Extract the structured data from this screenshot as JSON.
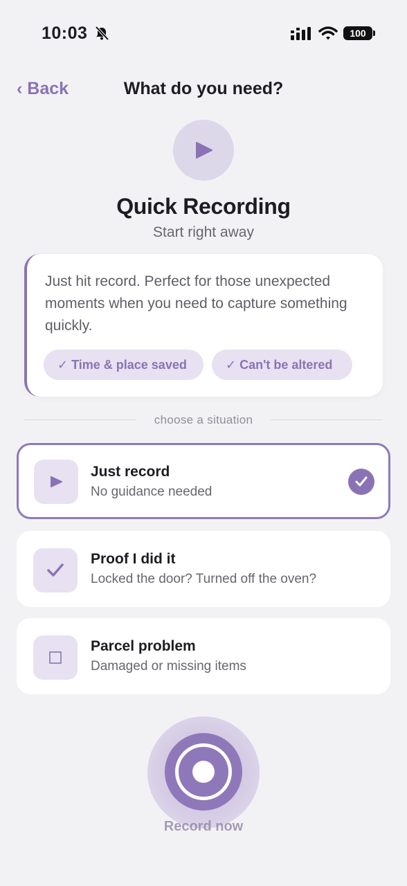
{
  "status_bar": {
    "time": "10:03",
    "battery": "100"
  },
  "nav": {
    "back_label": "‹ Back",
    "title": "What do you need?"
  },
  "hero": {
    "icon": "play-icon",
    "title": "Quick Recording",
    "subtitle": "Start right away"
  },
  "info_card": {
    "text": "Just hit record. Perfect for those unexpected moments when you need to capture something quickly.",
    "pills": [
      "✓ Time & place saved",
      "✓ Can't be altered"
    ]
  },
  "divider_label": "choose a situation",
  "options": [
    {
      "icon": "play-icon",
      "title": "Just record",
      "subtitle": "No guidance needed",
      "selected": true
    },
    {
      "icon": "checkmark-icon",
      "title": "Proof I did it",
      "subtitle": "Locked the door? Turned off the oven?",
      "selected": false
    },
    {
      "icon": "square-icon",
      "title": "Parcel problem",
      "subtitle": "Damaged or missing items",
      "selected": false
    }
  ],
  "record": {
    "label": "Record now"
  },
  "colors": {
    "accent": "#8a73b4",
    "accent_light": "#e7e1f1",
    "background": "#f2f2f5"
  }
}
